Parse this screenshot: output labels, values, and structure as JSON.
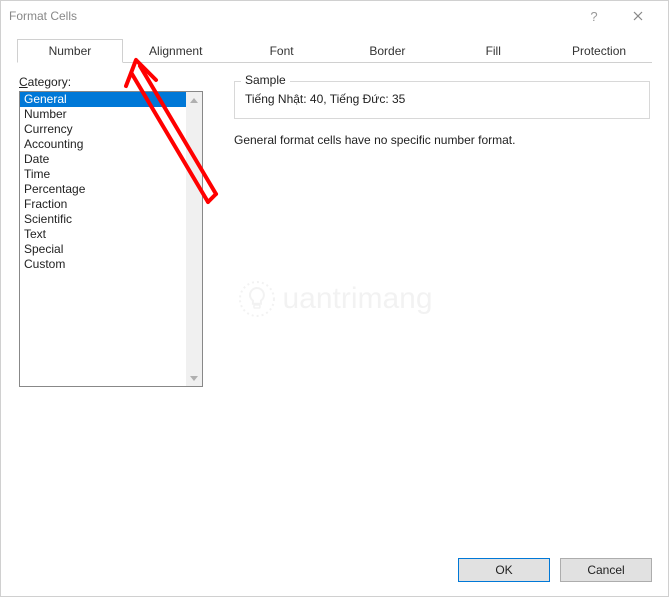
{
  "title": "Format Cells",
  "tabs": {
    "number": "Number",
    "alignment": "Alignment",
    "font": "Font",
    "border": "Border",
    "fill": "Fill",
    "protection": "Protection"
  },
  "category_label_u": "C",
  "category_label_rest": "ategory:",
  "categories": {
    "i0": "General",
    "i1": "Number",
    "i2": "Currency",
    "i3": "Accounting",
    "i4": "Date",
    "i5": "Time",
    "i6": "Percentage",
    "i7": "Fraction",
    "i8": "Scientific",
    "i9": "Text",
    "i10": "Special",
    "i11": "Custom"
  },
  "sample_legend": "Sample",
  "sample_value": "Tiếng Nhật: 40, Tiếng Đức: 35",
  "description": "General format cells have no specific number format.",
  "buttons": {
    "ok": "OK",
    "cancel": "Cancel"
  },
  "watermark": "uantrimang"
}
